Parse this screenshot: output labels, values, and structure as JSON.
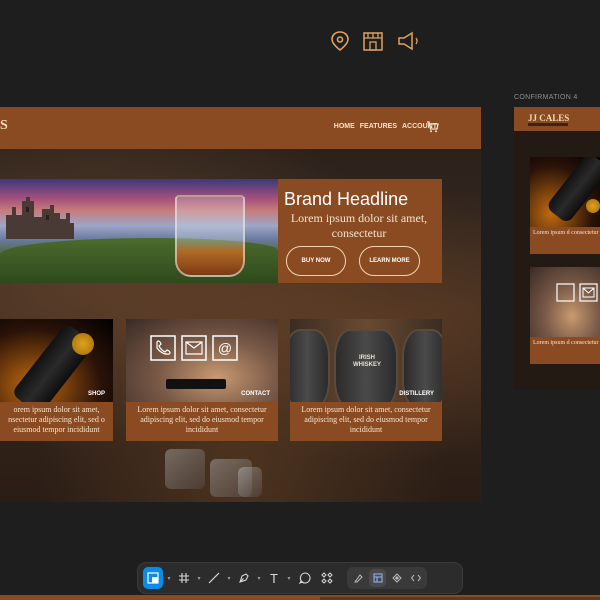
{
  "top_icons": [
    "map-pin-icon",
    "storefront-icon",
    "megaphone-icon"
  ],
  "main_frame": {
    "logo_fragment": "S",
    "nav": [
      "HOME",
      "FEATURES",
      "ACCOUNT"
    ],
    "hero": {
      "title": "Brand Headline",
      "subtitle": "Lorem ipsum dolor sit amet, consectetur",
      "buy_label": "BUY NOW",
      "learn_label": "LEARN MORE"
    },
    "cards": [
      {
        "tag": "SHOP",
        "text": "orem ipsum dolor sit amet, nsectetur adipiscing elit, sed o eiusmod tempor incididunt"
      },
      {
        "tag": "CONTACT",
        "text": "Lorem ipsum dolor sit amet, consectetur adipiscing elit, sed do eiusmod tempor incididunt"
      },
      {
        "tag": "DISTILLERY",
        "text": "Lorem ipsum dolor sit amet, consectetur adipiscing elit, sed do eiusmod tempor incididunt"
      }
    ],
    "barrel_label": "IRISH WHISKEY"
  },
  "right_frame": {
    "label": "CONFIRMATION 4",
    "logo": "JJ CALES",
    "cards": [
      {
        "text": "Lorem ipsum d consectetur ad do eiusmod te"
      },
      {
        "text": "Lorem ipsum d consectetur ad do eiusmod te"
      }
    ]
  },
  "toolbar": {
    "tools": [
      "frame-tool",
      "grid-tool",
      "line-tool",
      "pen-tool",
      "text-tool",
      "comment-tool",
      "components-tool"
    ],
    "text_tool_label": "T",
    "mode_buttons": [
      "draw-mode",
      "design-mode",
      "prototype-mode",
      "dev-mode"
    ]
  },
  "colors": {
    "brand_brown": "#8a4a22",
    "accent_blue": "#0c8ce9",
    "cream": "#f4e3c6"
  }
}
